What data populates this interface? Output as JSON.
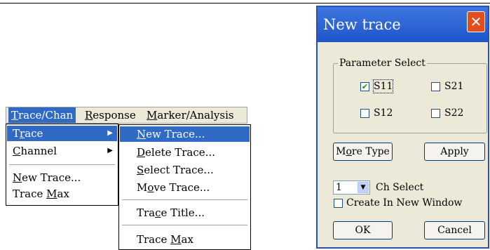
{
  "menubar": {
    "items": [
      "Trace/Chan",
      "Response",
      "Marker/Analysis"
    ],
    "underline": [
      "T",
      "R",
      "M"
    ],
    "rest": [
      "race/Chan",
      "esponse",
      "arker/Analysis"
    ]
  },
  "menu1": {
    "trace": {
      "pre": "T",
      "u": "r",
      "post": "ace"
    },
    "channel": {
      "pre": "",
      "u": "C",
      "post": "hannel"
    },
    "new_trace": {
      "pre": "",
      "u": "N",
      "post": "ew Trace..."
    },
    "trace_max": {
      "pre": "Trace ",
      "u": "M",
      "post": "ax"
    }
  },
  "menu2": {
    "new_trace": {
      "pre": "",
      "u": "N",
      "post": "ew Trace..."
    },
    "delete_trace": {
      "pre": "",
      "u": "D",
      "post": "elete Trace..."
    },
    "select_trace": {
      "pre": "",
      "u": "S",
      "post": "elect Trace..."
    },
    "move_trace": {
      "pre": "M",
      "u": "o",
      "post": "ve Trace..."
    },
    "trace_title": {
      "pre": "Tra",
      "u": "c",
      "post": "e Title..."
    },
    "trace_max": {
      "pre": "Trace ",
      "u": "M",
      "post": "ax"
    }
  },
  "dialog": {
    "title": "New trace",
    "close_glyph": "✕",
    "group_label": "Parameter Select",
    "params": [
      {
        "label": "S11",
        "checked": true
      },
      {
        "label": "S21",
        "checked": false
      },
      {
        "label": "S12",
        "checked": false
      },
      {
        "label": "S22",
        "checked": false
      }
    ],
    "check_mark": "✔",
    "more_type": {
      "pre": "M",
      "u": "o",
      "post": "re Type"
    },
    "apply_label": "Apply",
    "channel_value": "1",
    "channel_label": "Ch Select",
    "create_new_window": {
      "label": "Create In New Window",
      "checked": false
    },
    "ok_label": "OK",
    "cancel_label": "Cancel"
  },
  "colors": {
    "menu_highlight": "#316ac5",
    "titlebar": "#1f55c9",
    "close_button": "#e44e1e",
    "dialog_face": "#ece9d8"
  }
}
